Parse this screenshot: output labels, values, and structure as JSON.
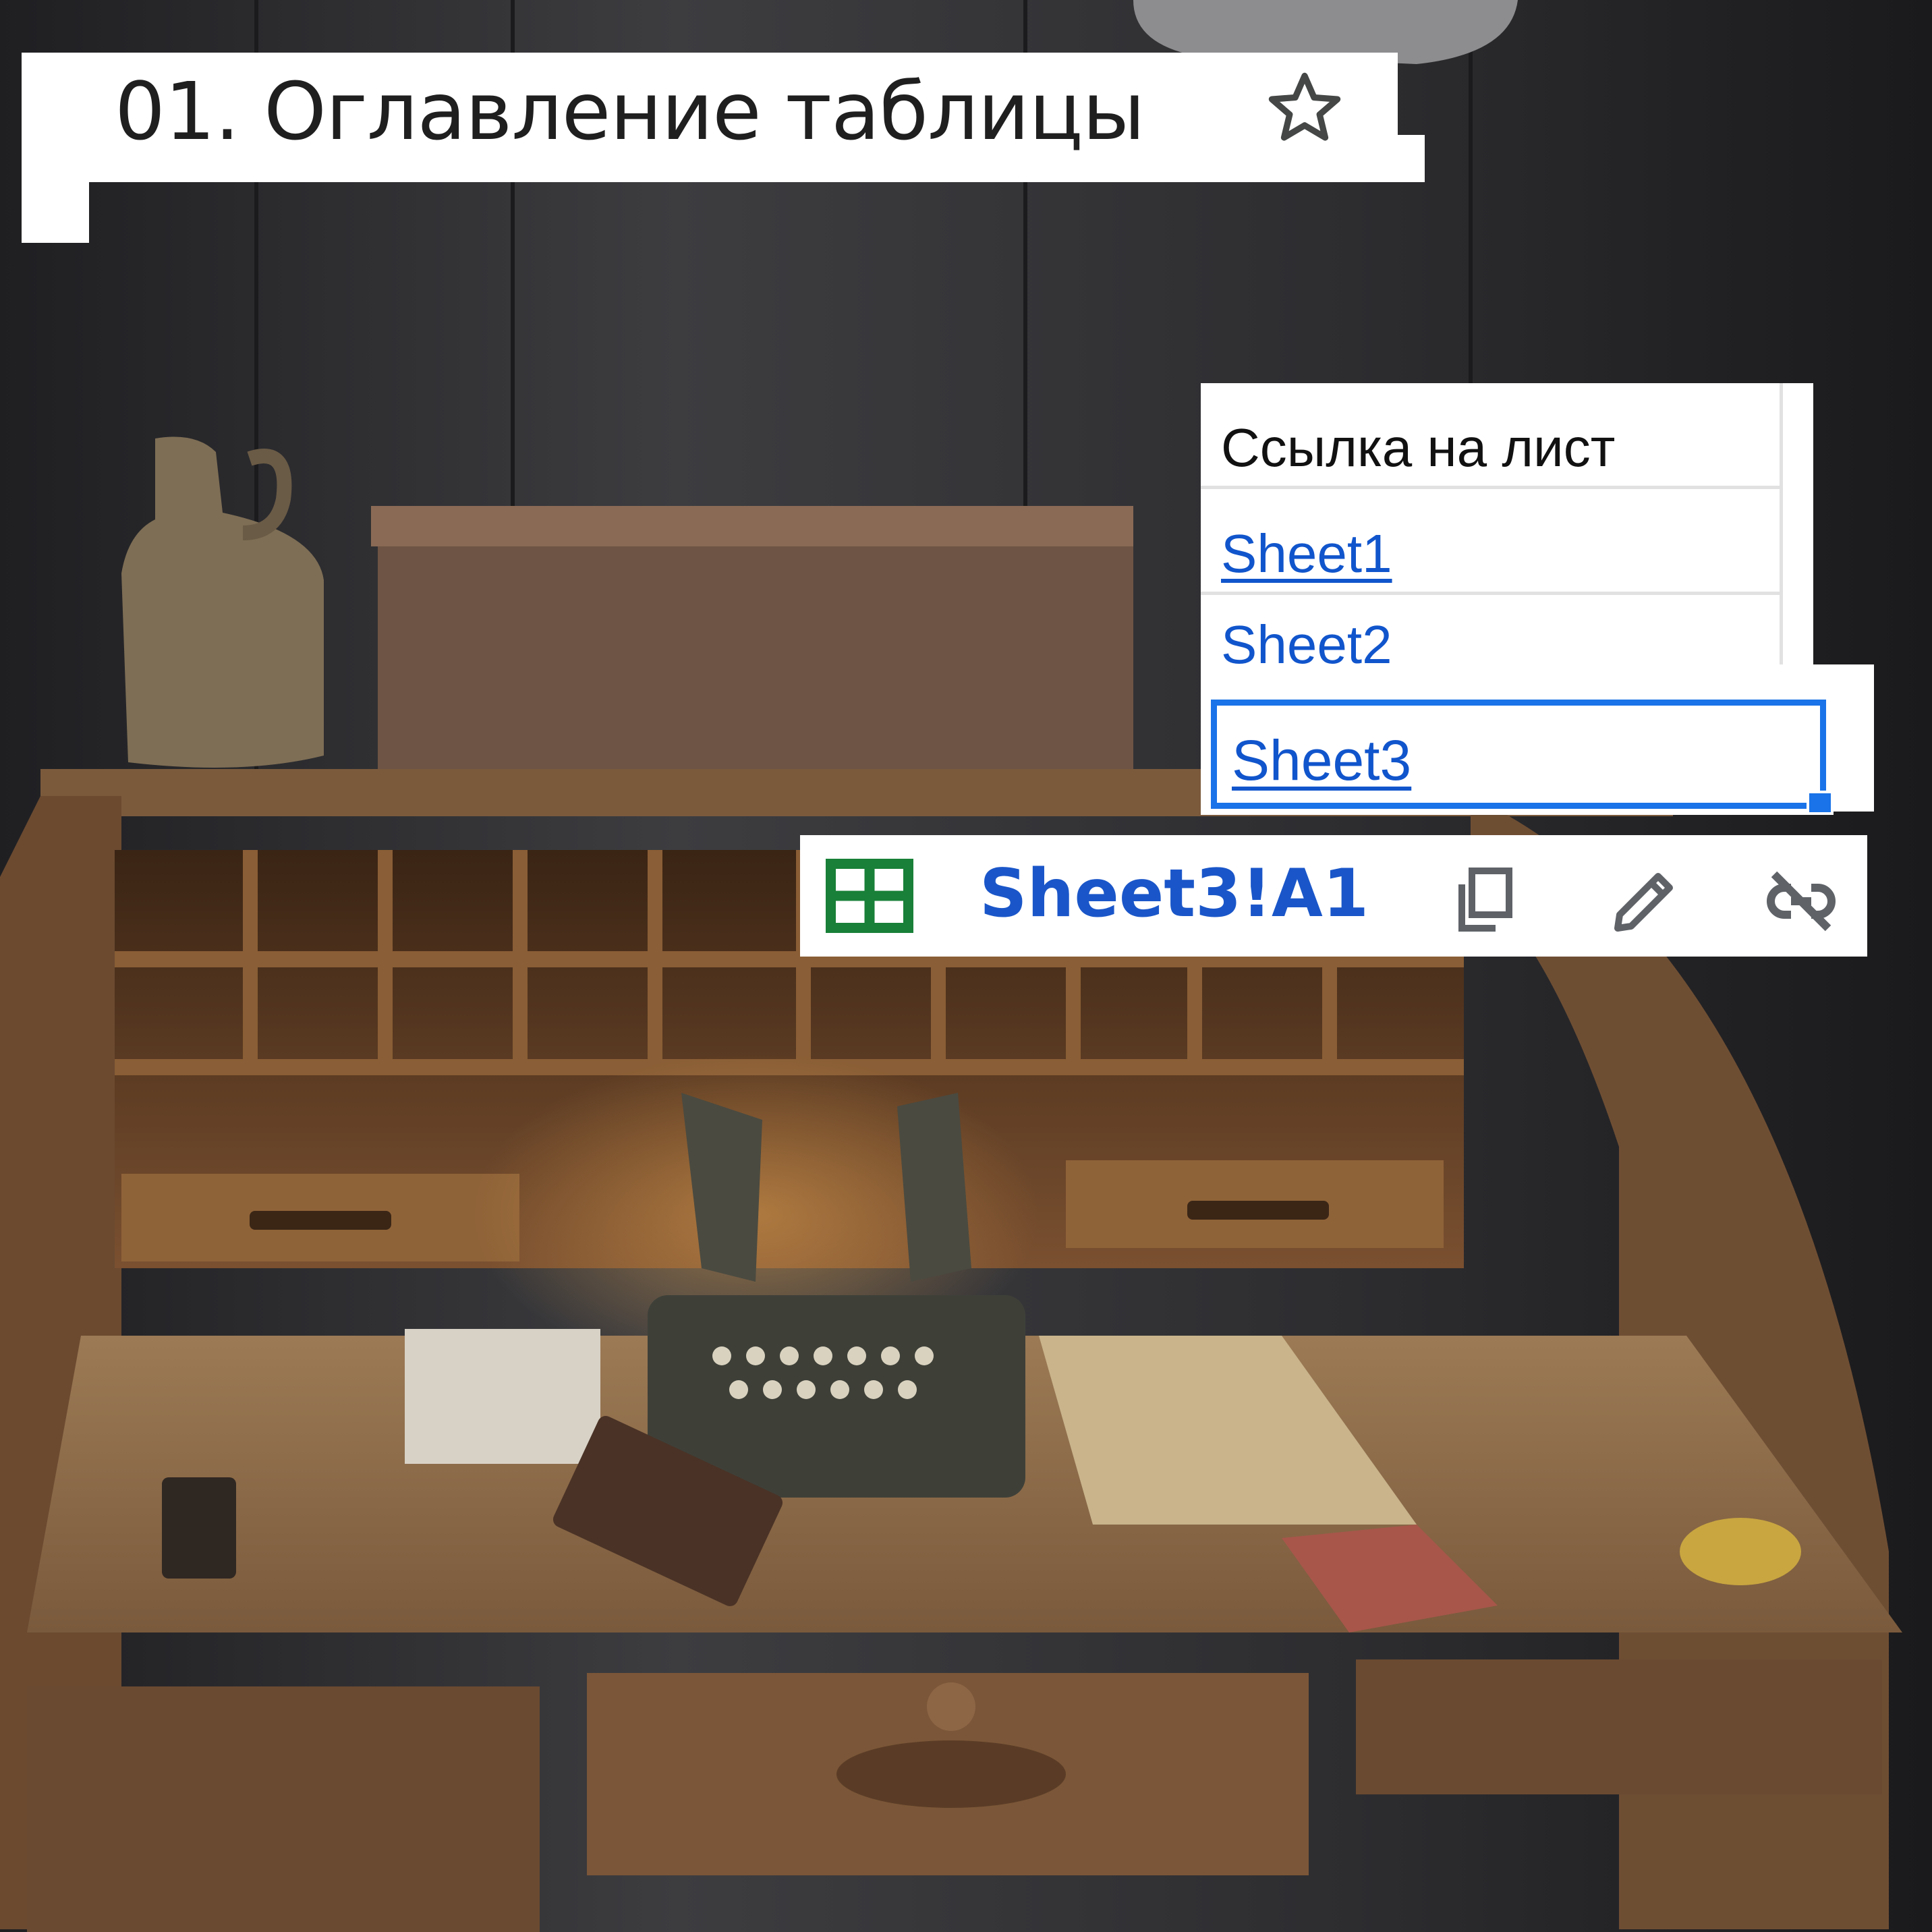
{
  "document": {
    "title": "01. Оглавление таблицы"
  },
  "sheet": {
    "header": "Ссылка на лист",
    "links": [
      {
        "label": "Sheet1"
      },
      {
        "label": "Sheet2"
      },
      {
        "label": "Sheet3",
        "selected": true
      }
    ]
  },
  "link_popup": {
    "target": "Sheet3!A1",
    "actions": [
      "copy-link",
      "edit-link",
      "remove-link"
    ]
  },
  "colors": {
    "link": "#1155cc",
    "selection": "#1a73e8",
    "sheets_green": "#188038",
    "icon_gray": "#5f6368"
  },
  "icons": [
    "star-icon",
    "google-sheets-icon",
    "copy-icon",
    "pencil-icon",
    "link-off-icon"
  ]
}
